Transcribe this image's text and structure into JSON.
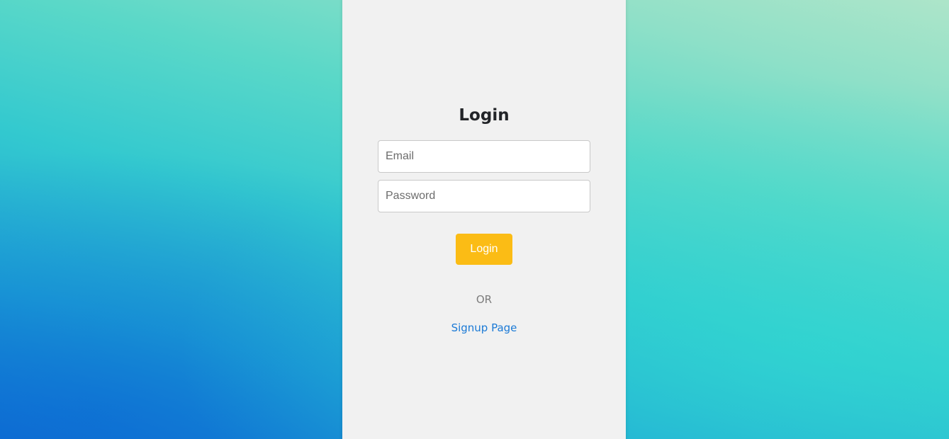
{
  "colors": {
    "background_gradient": [
      "#0f72d4",
      "#33c9cf",
      "#ade5c9"
    ],
    "card_background": "#f1f1f1",
    "button_background": "#fbbc15",
    "link_color": "#1b7ad6"
  },
  "login": {
    "title": "Login",
    "email": {
      "placeholder": "Email",
      "value": ""
    },
    "password": {
      "placeholder": "Password",
      "value": ""
    },
    "submit_label": "Login",
    "separator": "OR",
    "signup_link": "Signup Page"
  }
}
